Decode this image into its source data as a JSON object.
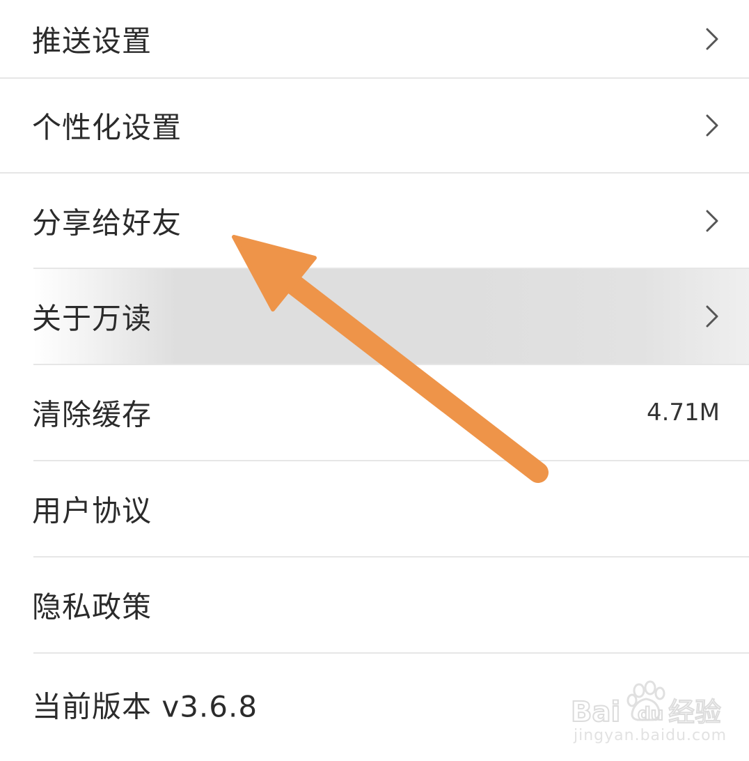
{
  "settings": {
    "items": [
      {
        "label": "推送设置",
        "has_chevron": true
      },
      {
        "label": "个性化设置",
        "has_chevron": true
      },
      {
        "label": "分享给好友",
        "has_chevron": true
      },
      {
        "label": "关于万读",
        "has_chevron": true
      },
      {
        "label": "清除缓存",
        "value": "4.71M"
      },
      {
        "label": "用户协议"
      },
      {
        "label": "隐私政策"
      },
      {
        "label": "当前版本 v3.6.8"
      }
    ]
  },
  "annotation": {
    "arrow_color": "#EE9449",
    "arrow_target": "分享给好友"
  },
  "watermark": {
    "logo_text": "Baidu经验",
    "url": "jingyan.baidu.com"
  },
  "colors": {
    "text": "#2b2b2b",
    "divider": "#e6e6e6",
    "highlight": "#dedede"
  },
  "icons": {
    "chevron": "chevron-right-icon"
  }
}
